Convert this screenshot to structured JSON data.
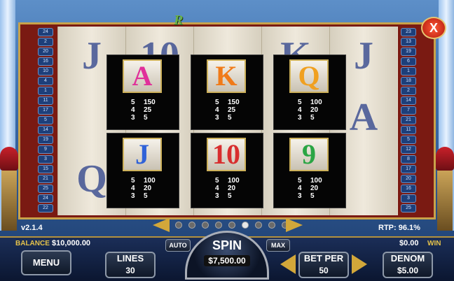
{
  "version": "v2.1.4",
  "rtp": "RTP: 96.1%",
  "balance": {
    "label": "BALANCE",
    "value": "$10,000.00"
  },
  "win": {
    "value": "$0.00",
    "label": "WIN"
  },
  "close_label": "X",
  "buttons": {
    "menu": "MENU",
    "lines_label": "LINES",
    "lines_value": "30",
    "auto": "AUTO",
    "max": "MAX",
    "spin_label": "SPIN",
    "spin_value": "$7,500.00",
    "betper_label": "BET PER",
    "betper_value": "50",
    "denom_label": "DENOM",
    "denom_value": "$5.00"
  },
  "paytable": [
    {
      "symbol": "A",
      "color": "#e0309a",
      "pays": [
        {
          "count": "5",
          "value": "150"
        },
        {
          "count": "4",
          "value": "25"
        },
        {
          "count": "3",
          "value": "5"
        }
      ]
    },
    {
      "symbol": "K",
      "color": "#f07a18",
      "pays": [
        {
          "count": "5",
          "value": "150"
        },
        {
          "count": "4",
          "value": "25"
        },
        {
          "count": "3",
          "value": "5"
        }
      ]
    },
    {
      "symbol": "Q",
      "color": "#f0a020",
      "pays": [
        {
          "count": "5",
          "value": "100"
        },
        {
          "count": "4",
          "value": "20"
        },
        {
          "count": "3",
          "value": "5"
        }
      ]
    },
    {
      "symbol": "J",
      "color": "#2f62d8",
      "pays": [
        {
          "count": "5",
          "value": "100"
        },
        {
          "count": "4",
          "value": "20"
        },
        {
          "count": "3",
          "value": "5"
        }
      ]
    },
    {
      "symbol": "10",
      "color": "#d82e2e",
      "pays": [
        {
          "count": "5",
          "value": "100"
        },
        {
          "count": "4",
          "value": "20"
        },
        {
          "count": "3",
          "value": "5"
        }
      ]
    },
    {
      "symbol": "9",
      "color": "#2aa544",
      "pays": [
        {
          "count": "5",
          "value": "100"
        },
        {
          "count": "4",
          "value": "20"
        },
        {
          "count": "3",
          "value": "5"
        }
      ]
    }
  ],
  "pager": {
    "count": 9,
    "active_index": 5
  },
  "reel_symbols": [
    "J",
    "10",
    "",
    "K",
    "J",
    "",
    "",
    "",
    "",
    "A",
    "Q",
    "",
    "",
    "",
    ""
  ],
  "line_numbers_left": [
    "24",
    "2",
    "20",
    "16",
    "10",
    "4",
    "1",
    "11",
    "17",
    "5",
    "14",
    "19",
    "9",
    "3",
    "15",
    "21",
    "25",
    "24",
    "22"
  ],
  "line_numbers_right": [
    "23",
    "13",
    "19",
    "6",
    "1",
    "18",
    "2",
    "14",
    "7",
    "21",
    "11",
    "5",
    "12",
    "8",
    "17",
    "20",
    "16",
    "3",
    "25"
  ]
}
